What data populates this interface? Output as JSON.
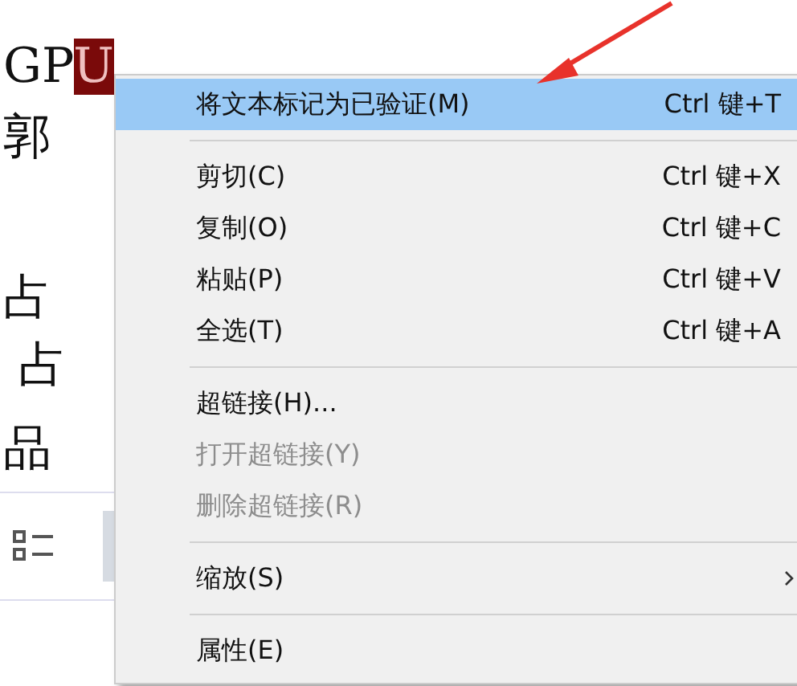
{
  "document": {
    "lines": [
      {
        "before": "GP",
        "selected": "U"
      },
      {
        "before": "郭"
      },
      {
        "before": "占"
      },
      {
        "before": " 占"
      },
      {
        "before": "品"
      }
    ]
  },
  "context_menu": {
    "items": [
      {
        "kind": "item",
        "label": "将文本标记为已验证(M)",
        "shortcut": "Ctrl 键+T",
        "selected": true,
        "disabled": false
      },
      {
        "kind": "separator"
      },
      {
        "kind": "item",
        "label": "剪切(C)",
        "shortcut": "Ctrl 键+X",
        "selected": false,
        "disabled": false
      },
      {
        "kind": "item",
        "label": "复制(O)",
        "shortcut": "Ctrl 键+C",
        "selected": false,
        "disabled": false
      },
      {
        "kind": "item",
        "label": "粘贴(P)",
        "shortcut": "Ctrl 键+V",
        "selected": false,
        "disabled": false
      },
      {
        "kind": "item",
        "label": "全选(T)",
        "shortcut": "Ctrl 键+A",
        "selected": false,
        "disabled": false
      },
      {
        "kind": "separator"
      },
      {
        "kind": "item",
        "label": "超链接(H)...",
        "selected": false,
        "disabled": false
      },
      {
        "kind": "item",
        "label": "打开超链接(Y)",
        "selected": false,
        "disabled": true
      },
      {
        "kind": "item",
        "label": "删除超链接(R)",
        "selected": false,
        "disabled": true
      },
      {
        "kind": "separator"
      },
      {
        "kind": "submenu",
        "label": "缩放(S)",
        "selected": false,
        "disabled": false
      },
      {
        "kind": "separator"
      },
      {
        "kind": "item",
        "label": "属性(E)",
        "selected": false,
        "disabled": false
      }
    ]
  }
}
